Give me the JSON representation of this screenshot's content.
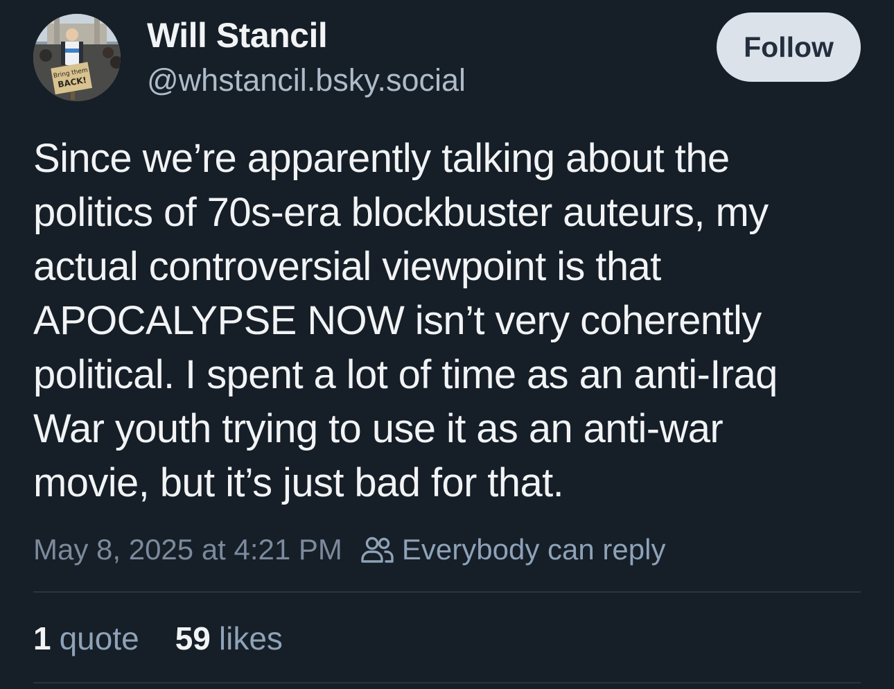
{
  "author": {
    "display_name": "Will Stancil",
    "handle": "@whstancil.bsky.social",
    "avatar_sign_text": [
      "Bring them",
      "BACK!"
    ]
  },
  "follow_button": {
    "label": "Follow"
  },
  "post": {
    "text_lines": [
      "Since we’re apparently talking about the",
      "politics of 70s-era blockbuster auteurs, my",
      "actual controversial viewpoint is that",
      "APOCALYPSE NOW isn’t very coherently",
      "political. I spent a lot of time as an anti-Iraq",
      "War youth trying to use it as an anti-war",
      "movie, but it’s just bad for that."
    ],
    "timestamp": "May 8, 2025 at 4:21 PM",
    "reply_setting": {
      "icon": "people-icon",
      "label": "Everybody can reply"
    }
  },
  "stats": {
    "quotes": {
      "count": "1",
      "label": "quote"
    },
    "likes": {
      "count": "59",
      "label": "likes"
    }
  },
  "colors": {
    "background": "#161e27",
    "text_primary": "#f1f3f5",
    "text_secondary": "#aebbc9",
    "text_muted": "#7b8a9c",
    "link_muted": "#8ea2b8",
    "follow_bg": "#dce2ea",
    "follow_text": "#232e3e",
    "divider": "#2a3440"
  }
}
